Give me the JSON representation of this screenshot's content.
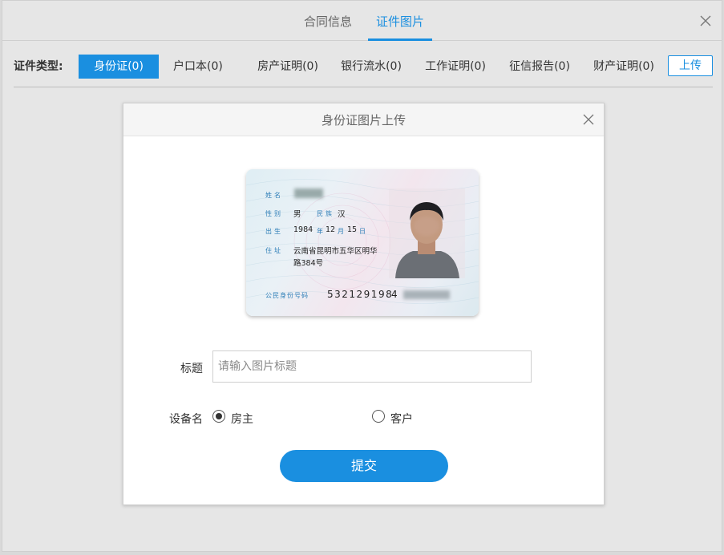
{
  "top_tabs": [
    {
      "label": "合同信息",
      "active": false
    },
    {
      "label": "证件图片",
      "active": true
    }
  ],
  "type_bar": {
    "label": "证件类型:",
    "types": [
      {
        "label": "身份证(0)",
        "active": true
      },
      {
        "label": "户口本(0)",
        "active": false
      },
      {
        "label": "房产证明(0)",
        "active": false
      },
      {
        "label": "银行流水(0)",
        "active": false
      },
      {
        "label": "工作证明(0)",
        "active": false
      },
      {
        "label": "征信报告(0)",
        "active": false
      },
      {
        "label": "财产证明(0)",
        "active": false
      }
    ],
    "upload_label": "上传"
  },
  "modal": {
    "title": "身份证图片上传",
    "id_card": {
      "name_label": "姓名",
      "name_value": "",
      "sex_label": "性别",
      "sex_value": "男",
      "ethnicity_label": "民族",
      "ethnicity_value": "汉",
      "birth_label": "出生",
      "birth_year": "1984",
      "year_unit": "年",
      "birth_month": "12",
      "month_unit": "月",
      "birth_day": "15",
      "day_unit": "日",
      "address_label": "住址",
      "address_line1": "云南省昆明市五华区明华",
      "address_line2": "路384号",
      "id_label": "公民身份号码",
      "id_number_visible": "532129198",
      "id_number_partial": "4"
    },
    "form": {
      "title_label": "标题",
      "title_placeholder": "请输入图片标题",
      "title_value": "",
      "device_label": "设备名",
      "options": [
        {
          "label": "房主",
          "checked": true
        },
        {
          "label": "客户",
          "checked": false
        }
      ],
      "submit_label": "提交"
    }
  },
  "colors": {
    "accent": "#1a8fe0",
    "card_label": "#2f7fb8"
  }
}
